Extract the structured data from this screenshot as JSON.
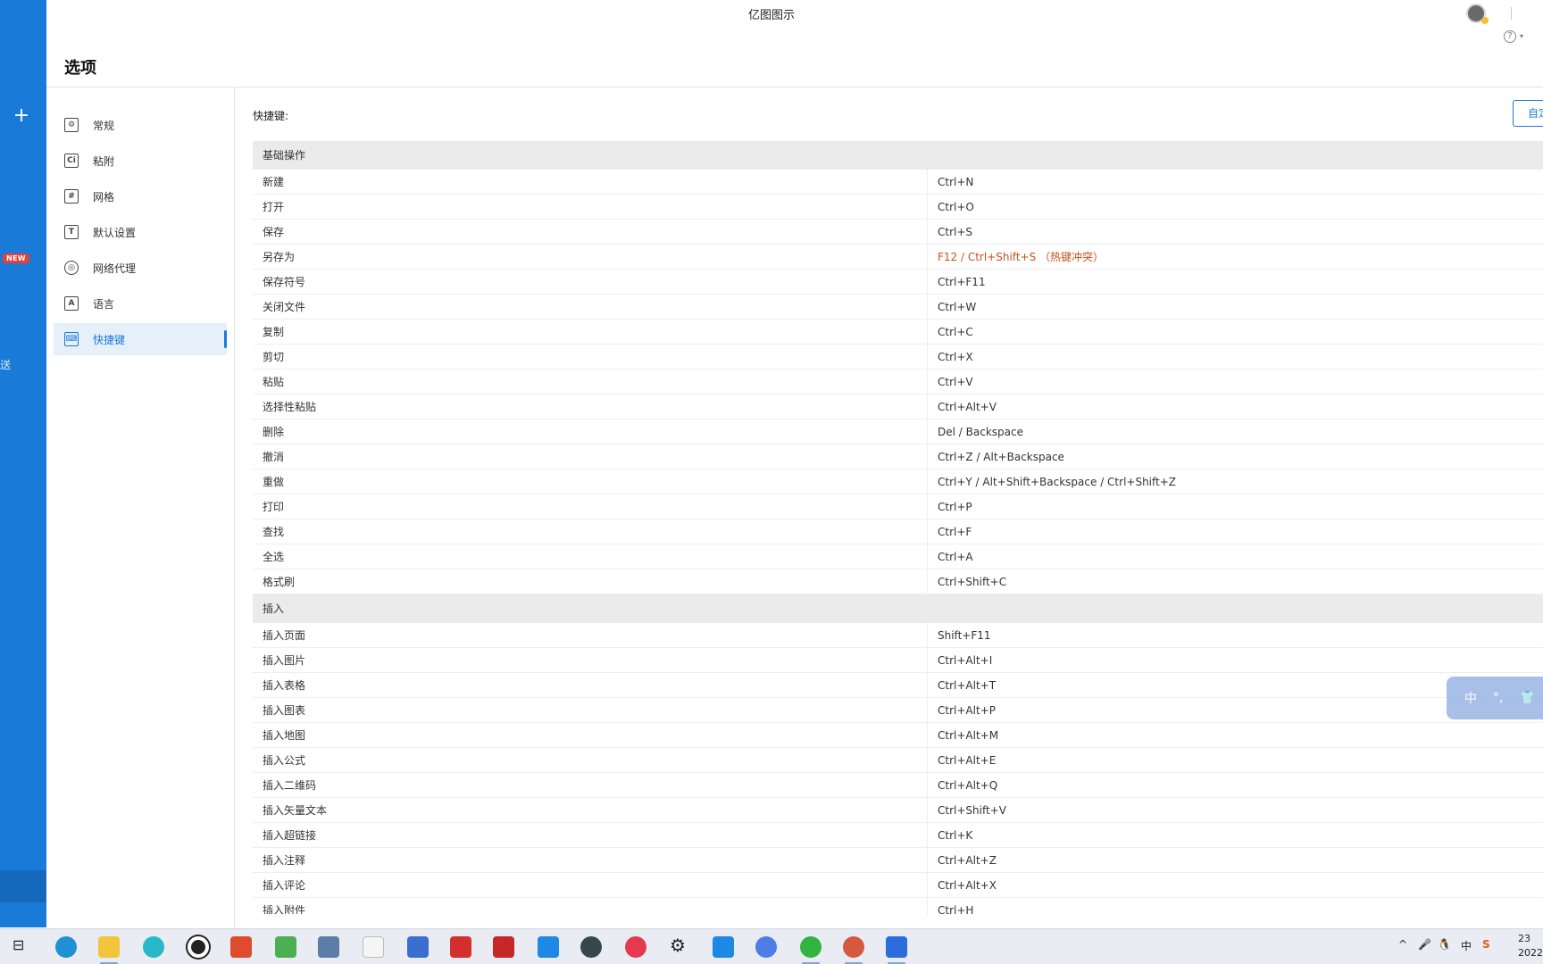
{
  "app": {
    "title": "亿图图示",
    "rail_badge": "NEW",
    "rail_side_text": "送"
  },
  "dialog": {
    "title": "选项",
    "shortcut_label": "快捷键:",
    "reset_button": "自定义"
  },
  "nav": [
    {
      "label": "常规",
      "icon": "gear-doc-icon",
      "glyph": "⚙"
    },
    {
      "label": "粘附",
      "icon": "snap-icon",
      "glyph": "Ci"
    },
    {
      "label": "网格",
      "icon": "grid-icon",
      "glyph": "#"
    },
    {
      "label": "默认设置",
      "icon": "text-icon",
      "glyph": "T"
    },
    {
      "label": "网络代理",
      "icon": "globe-icon",
      "glyph": "◎"
    },
    {
      "label": "语言",
      "icon": "language-icon",
      "glyph": "A"
    },
    {
      "label": "快捷键",
      "icon": "keyboard-icon",
      "glyph": "⌨",
      "active": true
    }
  ],
  "sections": [
    {
      "title": "基础操作",
      "rows": [
        {
          "name": "新建",
          "keys": "Ctrl+N"
        },
        {
          "name": "打开",
          "keys": "Ctrl+O"
        },
        {
          "name": "保存",
          "keys": "Ctrl+S"
        },
        {
          "name": "另存为",
          "keys": "F12 / Ctrl+Shift+S （热键冲突）",
          "conflict": true
        },
        {
          "name": "保存符号",
          "keys": "Ctrl+F11"
        },
        {
          "name": "关闭文件",
          "keys": "Ctrl+W"
        },
        {
          "name": "复制",
          "keys": "Ctrl+C"
        },
        {
          "name": "剪切",
          "keys": "Ctrl+X"
        },
        {
          "name": "粘贴",
          "keys": "Ctrl+V"
        },
        {
          "name": "选择性粘贴",
          "keys": "Ctrl+Alt+V"
        },
        {
          "name": "删除",
          "keys": "Del / Backspace"
        },
        {
          "name": "撤消",
          "keys": "Ctrl+Z / Alt+Backspace"
        },
        {
          "name": "重做",
          "keys": "Ctrl+Y / Alt+Shift+Backspace / Ctrl+Shift+Z"
        },
        {
          "name": "打印",
          "keys": "Ctrl+P"
        },
        {
          "name": "查找",
          "keys": "Ctrl+F"
        },
        {
          "name": "全选",
          "keys": "Ctrl+A"
        },
        {
          "name": "格式刷",
          "keys": "Ctrl+Shift+C"
        }
      ]
    },
    {
      "title": "插入",
      "rows": [
        {
          "name": "插入页面",
          "keys": "Shift+F11"
        },
        {
          "name": "插入图片",
          "keys": "Ctrl+Alt+I"
        },
        {
          "name": "插入表格",
          "keys": "Ctrl+Alt+T"
        },
        {
          "name": "插入图表",
          "keys": "Ctrl+Alt+P"
        },
        {
          "name": "插入地图",
          "keys": "Ctrl+Alt+M"
        },
        {
          "name": "插入公式",
          "keys": "Ctrl+Alt+E"
        },
        {
          "name": "插入二维码",
          "keys": "Ctrl+Alt+Q"
        },
        {
          "name": "插入矢量文本",
          "keys": "Ctrl+Shift+V"
        },
        {
          "name": "插入超链接",
          "keys": "Ctrl+K"
        },
        {
          "name": "插入注释",
          "keys": "Ctrl+Alt+Z"
        },
        {
          "name": "插入评论",
          "keys": "Ctrl+Alt+X"
        },
        {
          "name": "插入附件",
          "keys": "Ctrl+H"
        }
      ]
    }
  ],
  "ime": {
    "lang": "中",
    "punct": "°,",
    "skin": "👕"
  },
  "taskbar": {
    "tray_ime": "中",
    "tray_s": "S",
    "clock_line1": "23",
    "clock_line2": "2022"
  }
}
